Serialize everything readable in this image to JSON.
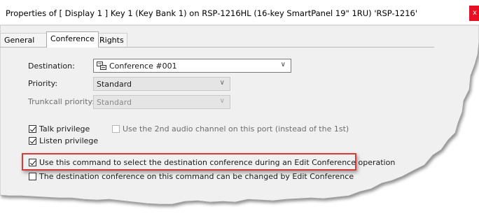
{
  "window": {
    "title": "Properties of [ Display 1 ] Key 1 (Key Bank 1) on RSP-1216HL (16-key SmartPanel 19\" 1RU) 'RSP-1216'",
    "close_glyph": "x"
  },
  "tabs": [
    {
      "label": "General",
      "active": false
    },
    {
      "label": "Conference",
      "active": true
    },
    {
      "label": "Rights",
      "active": false
    }
  ],
  "form": {
    "destination_label": "Destination:",
    "destination_value": "Conference #001",
    "destination_icon": "conference-icon",
    "priority_label": "Priority:",
    "priority_value": "Standard",
    "trunkcall_label": "Trunkcall priority:",
    "trunkcall_value": "Standard",
    "chevron": "∨"
  },
  "checkboxes": {
    "talk": {
      "label": "Talk privilege",
      "checked": true
    },
    "second_audio": {
      "label": "Use the 2nd audio channel on this port (instead of the 1st)",
      "checked": false
    },
    "listen": {
      "label": "Listen privilege",
      "checked": true
    },
    "select_dest": {
      "label": "Use this command to select the destination conference during an Edit Conference operation",
      "checked": true
    },
    "can_change": {
      "label": "The destination conference on this command can be changed by Edit Conference",
      "checked": false
    }
  },
  "colors": {
    "highlight": "#d63a3a",
    "close_button": "#e81123"
  }
}
